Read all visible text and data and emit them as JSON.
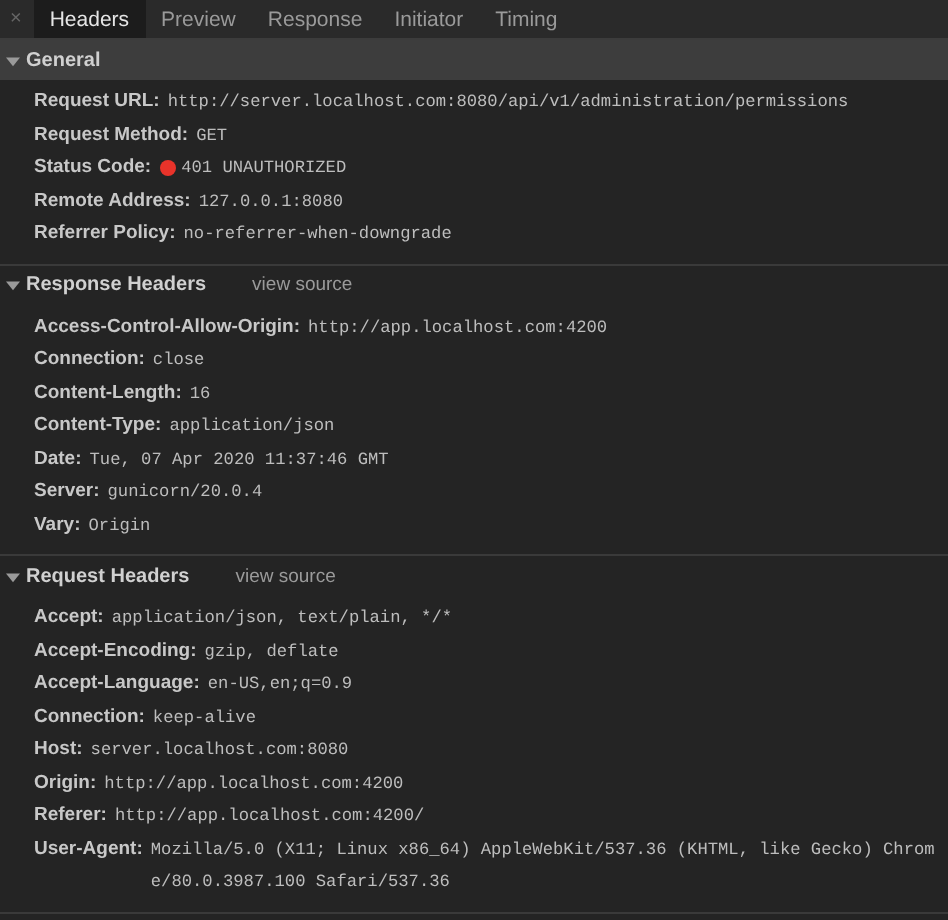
{
  "tabs": [
    {
      "label": "Headers",
      "selected": true
    },
    {
      "label": "Preview",
      "selected": false
    },
    {
      "label": "Response",
      "selected": false
    },
    {
      "label": "Initiator",
      "selected": false
    },
    {
      "label": "Timing",
      "selected": false
    }
  ],
  "close_icon": "×",
  "sections": [
    {
      "title": "General",
      "expanded": true,
      "selected": true,
      "rows": [
        {
          "name": "Request URL:",
          "value": "http://server.localhost.com:8080/api/v1/administration/permissions"
        },
        {
          "name": "Request Method:",
          "value": "GET"
        },
        {
          "name": "Status Code:",
          "value": "401 UNAUTHORIZED",
          "color": "#e8332a"
        },
        {
          "name": "Remote Address:",
          "value": "127.0.0.1:8080"
        },
        {
          "name": "Referrer Policy:",
          "value": "no-referrer-when-downgrade"
        }
      ]
    },
    {
      "title": "Response Headers",
      "expanded": true,
      "selected": false,
      "link": "view source",
      "rows": [
        {
          "name": "Access-Control-Allow-Origin:",
          "value": "http://app.localhost.com:4200"
        },
        {
          "name": "Connection:",
          "value": "close"
        },
        {
          "name": "Content-Length:",
          "value": "16"
        },
        {
          "name": "Content-Type:",
          "value": "application/json"
        },
        {
          "name": "Date:",
          "value": "Tue, 07 Apr 2020 11:37:46 GMT"
        },
        {
          "name": "Server:",
          "value": "gunicorn/20.0.4"
        },
        {
          "name": "Vary:",
          "value": "Origin"
        }
      ]
    },
    {
      "title": "Request Headers",
      "expanded": true,
      "selected": false,
      "link": "view source",
      "rows": [
        {
          "name": "Accept:",
          "value": "application/json, text/plain, */*"
        },
        {
          "name": "Accept-Encoding:",
          "value": "gzip, deflate"
        },
        {
          "name": "Accept-Language:",
          "value": "en-US,en;q=0.9"
        },
        {
          "name": "Connection:",
          "value": "keep-alive"
        },
        {
          "name": "Host:",
          "value": "server.localhost.com:8080"
        },
        {
          "name": "Origin:",
          "value": "http://app.localhost.com:4200"
        },
        {
          "name": "Referer:",
          "value": "http://app.localhost.com:4200/"
        },
        {
          "name": "User-Agent:",
          "value": "Mozilla/5.0 (X11; Linux x86_64) AppleWebKit/537.36 (KHTML, like Gecko) Chrome/80.0.3987.100 Safari/537.36"
        }
      ]
    }
  ]
}
